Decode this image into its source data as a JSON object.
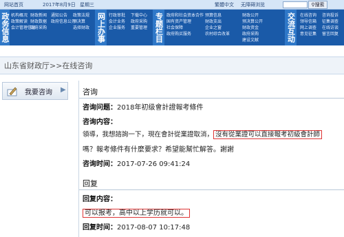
{
  "topbar": {
    "home": "网站首页",
    "date": "2017年8月9日",
    "weekday": "星期三",
    "lang": "繁體中文",
    "access": "无障碍浏览",
    "search_btn": "搜索",
    "search_icon": "magnifier-icon"
  },
  "nav": {
    "block1": "政务信息",
    "block2": "网上办事",
    "block3": "专题栏目",
    "block4": "交流互动",
    "col1": [
      "机构概况",
      "政策解读",
      "会计管理信息"
    ],
    "col2": [
      "财政新闻",
      "财政数据",
      "政府采购"
    ],
    "col3": [
      "通知公告",
      "政府信息公开"
    ],
    "col4": [
      "政策法规",
      "预决算",
      "选择财政"
    ],
    "col5": [
      "行政审批",
      "会计业务",
      "企业服务"
    ],
    "col6": [
      "下载中心",
      "政府采购",
      "重要管理"
    ],
    "col7": [
      "政府和社会资本合作",
      "国有资产管理",
      "社会保障",
      "政府购买服务"
    ],
    "col8": [
      "预算信息",
      "财政支出",
      "企业之窗",
      "农村综合改革"
    ],
    "col9": [
      "财政公开",
      "预决算公开",
      "财政资金",
      "政府采购",
      "建设文献"
    ],
    "col10": [
      "在线咨询",
      "领导信箱",
      "网上调查",
      "意见征集"
    ],
    "col11": [
      "咨询投诉",
      "征集调查",
      "在线访谈",
      "留言回复"
    ]
  },
  "breadcrumb": "山东省财政厅>>在线咨询",
  "sidebar": {
    "label": "我要咨询",
    "arrow": "▶",
    "icon": "pen-icon"
  },
  "consult": {
    "title": "咨询",
    "question_label": "咨询问题：",
    "question": "2018年初级會計證報考條件",
    "content_label": "咨询内容：",
    "content_line1_a": "領導，我想諮詢一下，現在會計從業證取消，",
    "content_line1_hl": "沒有從業證可以直接報考初級會計師",
    "content_line2": "嗎？報考條件有什麼要求？希望能幫忙解答。謝謝",
    "time_label": "咨询时间：",
    "time": "2017-07-26 09:41:24"
  },
  "reply": {
    "title": "回复",
    "content_label": "回复内容：",
    "content": "可以报考，高中以上学历就可以。",
    "time_label": "回复时间：",
    "time": "2017-08-07 10:17:48"
  }
}
